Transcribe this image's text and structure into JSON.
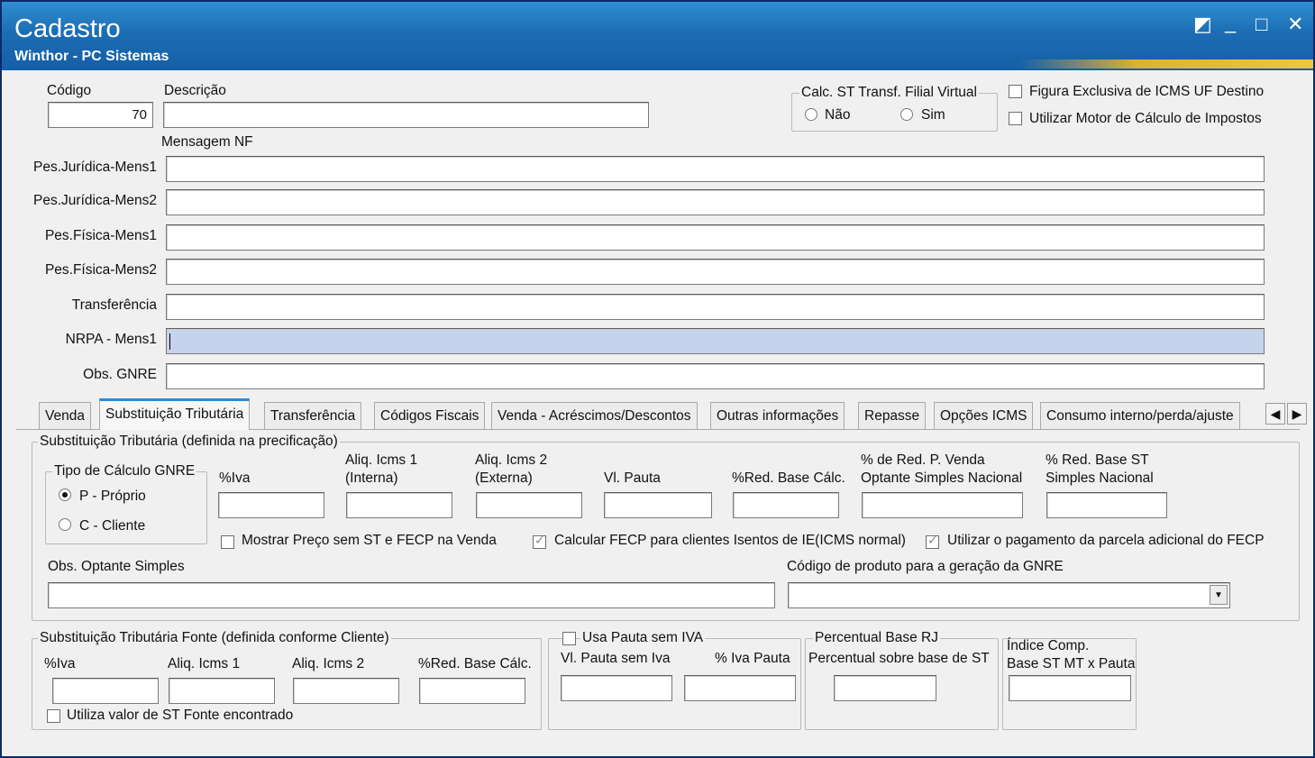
{
  "window": {
    "title": "Cadastro",
    "subtitle": "Winthor - PC Sistemas",
    "buttons": {
      "restore": "◩",
      "minimize": "_",
      "maximize": "□",
      "close": "✕"
    }
  },
  "header": {
    "codigo_label": "Código",
    "codigo_value": "70",
    "descricao_label": "Descrição",
    "descricao_value": "",
    "calc_st_group": "Calc. ST Transf. Filial Virtual",
    "radio_nao": "Não",
    "radio_sim": "Sim",
    "check_figura": "Figura Exclusiva de ICMS UF Destino",
    "check_motor": "Utilizar Motor de Cálculo de Impostos",
    "mensagem_nf": "Mensagem NF"
  },
  "messages": [
    {
      "label": "Pes.Jurídica-Mens1",
      "value": ""
    },
    {
      "label": "Pes.Jurídica-Mens2",
      "value": ""
    },
    {
      "label": "Pes.Física-Mens1",
      "value": ""
    },
    {
      "label": "Pes.Física-Mens2",
      "value": ""
    },
    {
      "label": "Transferência",
      "value": ""
    },
    {
      "label": "NRPA - Mens1",
      "value": ""
    },
    {
      "label": "Obs. GNRE",
      "value": ""
    }
  ],
  "tabs": [
    {
      "label": "Venda"
    },
    {
      "label": "Substituição Tributária",
      "active": true
    },
    {
      "label": "Transferência"
    },
    {
      "label": "Códigos Fiscais"
    },
    {
      "label": "Venda - Acréscimos/Descontos"
    },
    {
      "label": "Outras informações"
    },
    {
      "label": "Repasse"
    },
    {
      "label": "Opções ICMS"
    },
    {
      "label": "Consumo interno/perda/ajuste"
    }
  ],
  "tab_scroll": {
    "left": "◀",
    "right": "▶"
  },
  "st": {
    "group_title": "Substituição Tributária (definida na precificação)",
    "gnre_group": "Tipo de Cálculo GNRE",
    "radio_proprio": "P - Próprio",
    "radio_cliente": "C - Cliente",
    "fields": {
      "iva": "%Iva",
      "aliq1_l1": "Aliq. Icms 1",
      "aliq1_l2": "(Interna)",
      "aliq2_l1": "Aliq. Icms 2",
      "aliq2_l2": "(Externa)",
      "vl_pauta": "Vl. Pauta",
      "red_base": "%Red. Base Cálc.",
      "red_venda_l1": "% de Red. P. Venda",
      "red_venda_l2": "Optante Simples Nacional",
      "red_st_l1": "% Red. Base ST",
      "red_st_l2": "Simples Nacional"
    },
    "check_mostrar": "Mostrar Preço sem ST e FECP na Venda",
    "check_calcular": "Calcular FECP para clientes Isentos de IE(ICMS normal)",
    "check_utilizar": "Utilizar o pagamento da parcela adicional do FECP",
    "obs_optante": "Obs. Optante Simples",
    "codigo_produto": "Código de produto para a geração da GNRE",
    "combo_arrow": "▼"
  },
  "st_fonte": {
    "group_title": "Substituição Tributária Fonte (definida conforme Cliente)",
    "iva": "%Iva",
    "aliq1": "Aliq. Icms 1",
    "aliq2": "Aliq. Icms 2",
    "red_base": "%Red. Base Cálc.",
    "check_utiliza": "Utiliza valor de ST Fonte encontrado"
  },
  "pauta": {
    "check_label": "Usa Pauta sem IVA",
    "vl_pauta": "Vl. Pauta sem Iva",
    "iva_pauta": "% Iva Pauta"
  },
  "percentual_rj": {
    "group_title": "Percentual Base RJ",
    "label": "Percentual sobre base de ST"
  },
  "indice": {
    "label_l1": "Índice Comp.",
    "label_l2": "Base ST MT x Pauta"
  }
}
